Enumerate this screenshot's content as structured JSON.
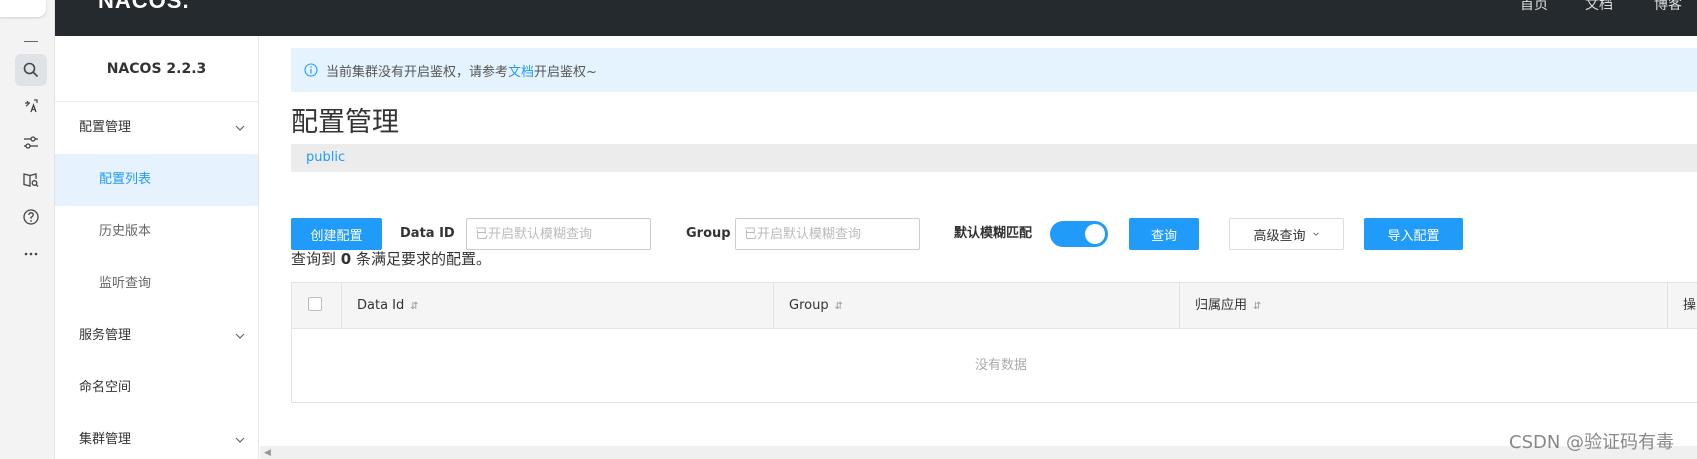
{
  "topbar": {
    "logo": "NACOS.",
    "nav": [
      "首页",
      "文档",
      "博客"
    ]
  },
  "sidebar": {
    "product": "NACOS 2.2.3",
    "groups": [
      {
        "label": "配置管理",
        "items": [
          "配置列表",
          "历史版本",
          "监听查询"
        ]
      },
      {
        "label": "服务管理"
      },
      {
        "label": "命名空间"
      },
      {
        "label": "集群管理"
      }
    ],
    "active_item": "配置列表"
  },
  "notice": {
    "before": "当前集群没有开启鉴权，请参考",
    "link": "文档",
    "after": "开启鉴权~"
  },
  "main": {
    "title": "配置管理",
    "namespace": "public",
    "create_button": "创建配置",
    "data_id_label": "Data ID",
    "data_id_placeholder": "已开启默认模糊查询",
    "group_label": "Group",
    "group_placeholder": "已开启默认模糊查询",
    "fuzzy_label": "默认模糊匹配",
    "fuzzy_enabled": true,
    "query_button": "查询",
    "advanced_query_button": "高级查询",
    "import_button": "导入配置",
    "result_prefix": "查询到",
    "result_count": "0",
    "result_suffix": "条满足要求的配置。"
  },
  "table": {
    "columns": [
      "Data Id",
      "Group",
      "归属应用",
      "操"
    ],
    "empty_text": "没有数据"
  },
  "watermark": "CSDN @验证码有毒",
  "colors": {
    "primary": "#209bfa",
    "topbar": "#252a2f",
    "notice_bg": "#e4f3fe"
  }
}
